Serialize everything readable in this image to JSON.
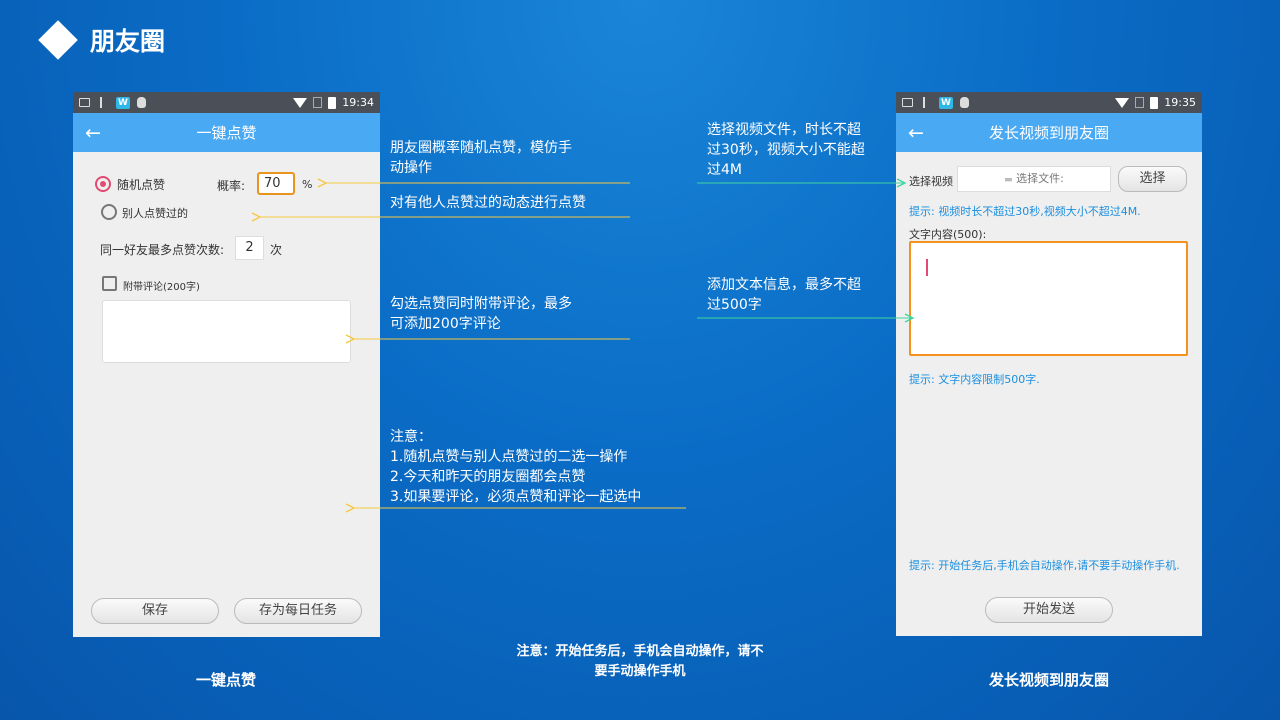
{
  "slide": {
    "title": "朋友圈"
  },
  "left_phone": {
    "time": "19:34",
    "title": "一键点赞",
    "random_like_label": "随机点赞",
    "rate_label": "概率:",
    "rate_value": "70",
    "rate_unit": "%",
    "others_liked_label": "别人点赞过的",
    "max_likes_label": "同一好友最多点赞次数:",
    "max_likes_value": "2",
    "max_likes_unit": "次",
    "comment_checkbox_label": "附带评论(200字)",
    "comment_text": "",
    "save_button": "保存",
    "daily_task_button": "存为每日任务"
  },
  "right_phone": {
    "time": "19:35",
    "title": "发长视频到朋友圈",
    "select_video_label": "选择视频",
    "select_file_placeholder": "选择文件:",
    "select_button": "选择",
    "hint_video": "提示: 视频时长不超过30秒,视频大小不超过4M.",
    "text_content_label": "文字内容(500):",
    "text_value": "",
    "hint_text": "提示: 文字内容限制500字.",
    "hint_auto": "提示: 开始任务后,手机会自动操作,请不要手动操作手机.",
    "start_button": "开始发送"
  },
  "annotations": {
    "random_like_line1": "朋友圈概率随机点赞，模仿手",
    "random_like_line2": "动操作",
    "others_liked": "对有他人点赞过的动态进行点赞",
    "comment_line1": "勾选点赞同时附带评论，最多",
    "comment_line2": "可添加200字评论",
    "notes_title": "注意：",
    "notes_1": "1.随机点赞与别人点赞过的二选一操作",
    "notes_2": "2.今天和昨天的朋友圈都会点赞",
    "notes_3": "3.如果要评论，必须点赞和评论一起选中",
    "video_line1": "选择视频文件，时长不超",
    "video_line2": "过30秒，视频大小不能超",
    "video_line3": "过4M",
    "text_line1": "添加文本信息，最多不超",
    "text_line2": "过500字",
    "bottom_note_line1": "注意：开始任务后，手机会自动操作，请不",
    "bottom_note_line2": "要手动操作手机"
  },
  "captions": {
    "left": "一键点赞",
    "right": "发长视频到朋友圈"
  },
  "colors": {
    "accent_pink": "#e34a73",
    "appbar_blue": "#4aa9f3",
    "highlight_orange": "#f3921f",
    "arrow_yellow": "#f5c842",
    "arrow_green": "#3ed6a0"
  }
}
